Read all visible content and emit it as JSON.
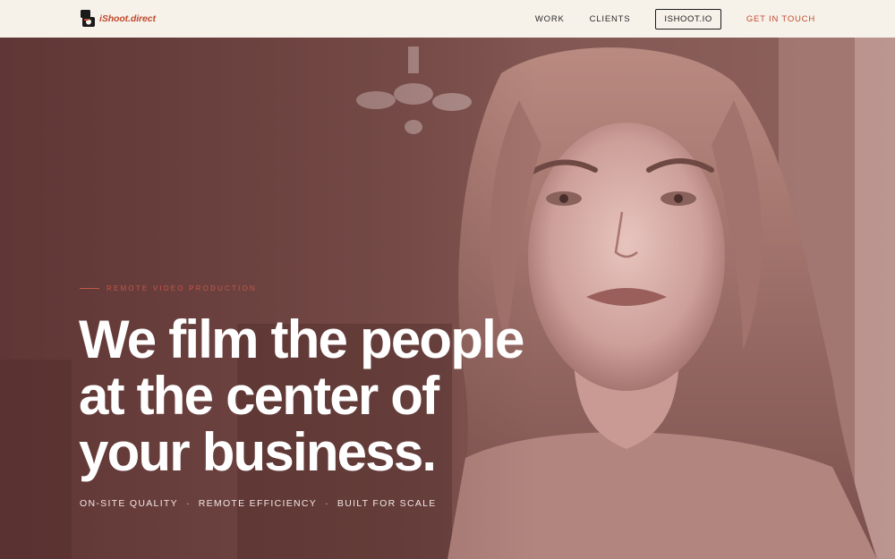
{
  "brand": {
    "name": "iShoot.direct",
    "accent": "#c24a2e"
  },
  "nav": {
    "work": "WORK",
    "clients": "CLIENTS",
    "ishoot": "ISHOOT.IO",
    "cta": "GET IN TOUCH"
  },
  "hero": {
    "eyebrow": "REMOTE VIDEO PRODUCTION",
    "headline": [
      "We film the people",
      "at the center of",
      "your business."
    ],
    "tags": [
      "ON-SITE QUALITY",
      "REMOTE EFFICIENCY",
      "BUILT FOR SCALE"
    ],
    "separator": "·"
  },
  "icons": {
    "logo": "camera-icon",
    "background": "hero-photo-woman"
  }
}
